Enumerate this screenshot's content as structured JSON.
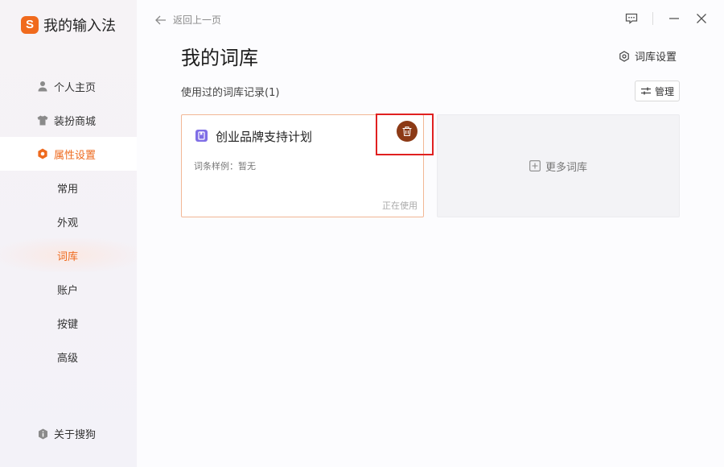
{
  "app": {
    "name": "我的输入法",
    "logo_letter": "S",
    "accent": "#ee6a1e"
  },
  "sidebar": {
    "items": [
      {
        "label": "个人主页",
        "icon": "person-icon"
      },
      {
        "label": "装扮商城",
        "icon": "tshirt-icon"
      },
      {
        "label": "属性设置",
        "icon": "hexagon-settings-icon",
        "active": true
      }
    ],
    "sub_items": [
      {
        "label": "常用"
      },
      {
        "label": "外观"
      },
      {
        "label": "词库",
        "active": true
      },
      {
        "label": "账户"
      },
      {
        "label": "按键"
      },
      {
        "label": "高级"
      }
    ],
    "about": {
      "label": "关于搜狗",
      "icon": "info-shield-icon"
    }
  },
  "topbar": {
    "back_label": "返回上一页",
    "controls": [
      "feedback-icon",
      "minimize-icon",
      "close-icon"
    ]
  },
  "main": {
    "title": "我的词库",
    "settings_label": "词库设置",
    "records_label": "使用过的词库记录(1)",
    "manage_label": "管理",
    "cards": [
      {
        "title": "创业品牌支持计划",
        "sample": "词条样例：暂无",
        "status": "正在使用",
        "delete_button_color": "#8c3a16"
      }
    ],
    "more_label": "更多词库"
  }
}
